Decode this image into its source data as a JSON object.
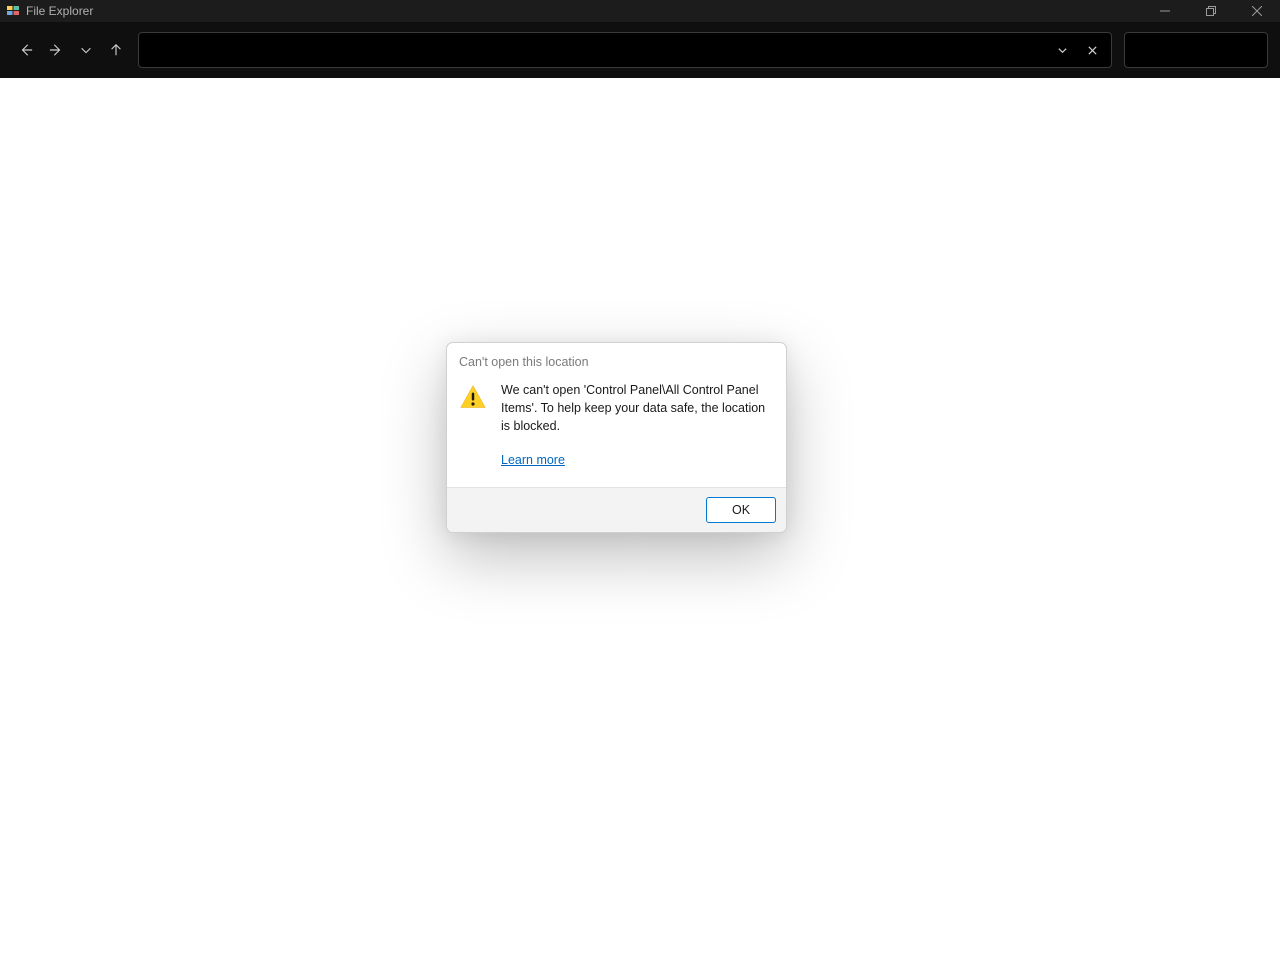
{
  "window": {
    "title": "File Explorer"
  },
  "nav": {
    "address_value": "",
    "search_value": ""
  },
  "dialog": {
    "title": "Can't open this location",
    "message": "We can't open 'Control Panel\\All Control Panel Items'. To help keep your data safe, the location is blocked.",
    "learn_more_label": "Learn more",
    "ok_label": "OK"
  }
}
